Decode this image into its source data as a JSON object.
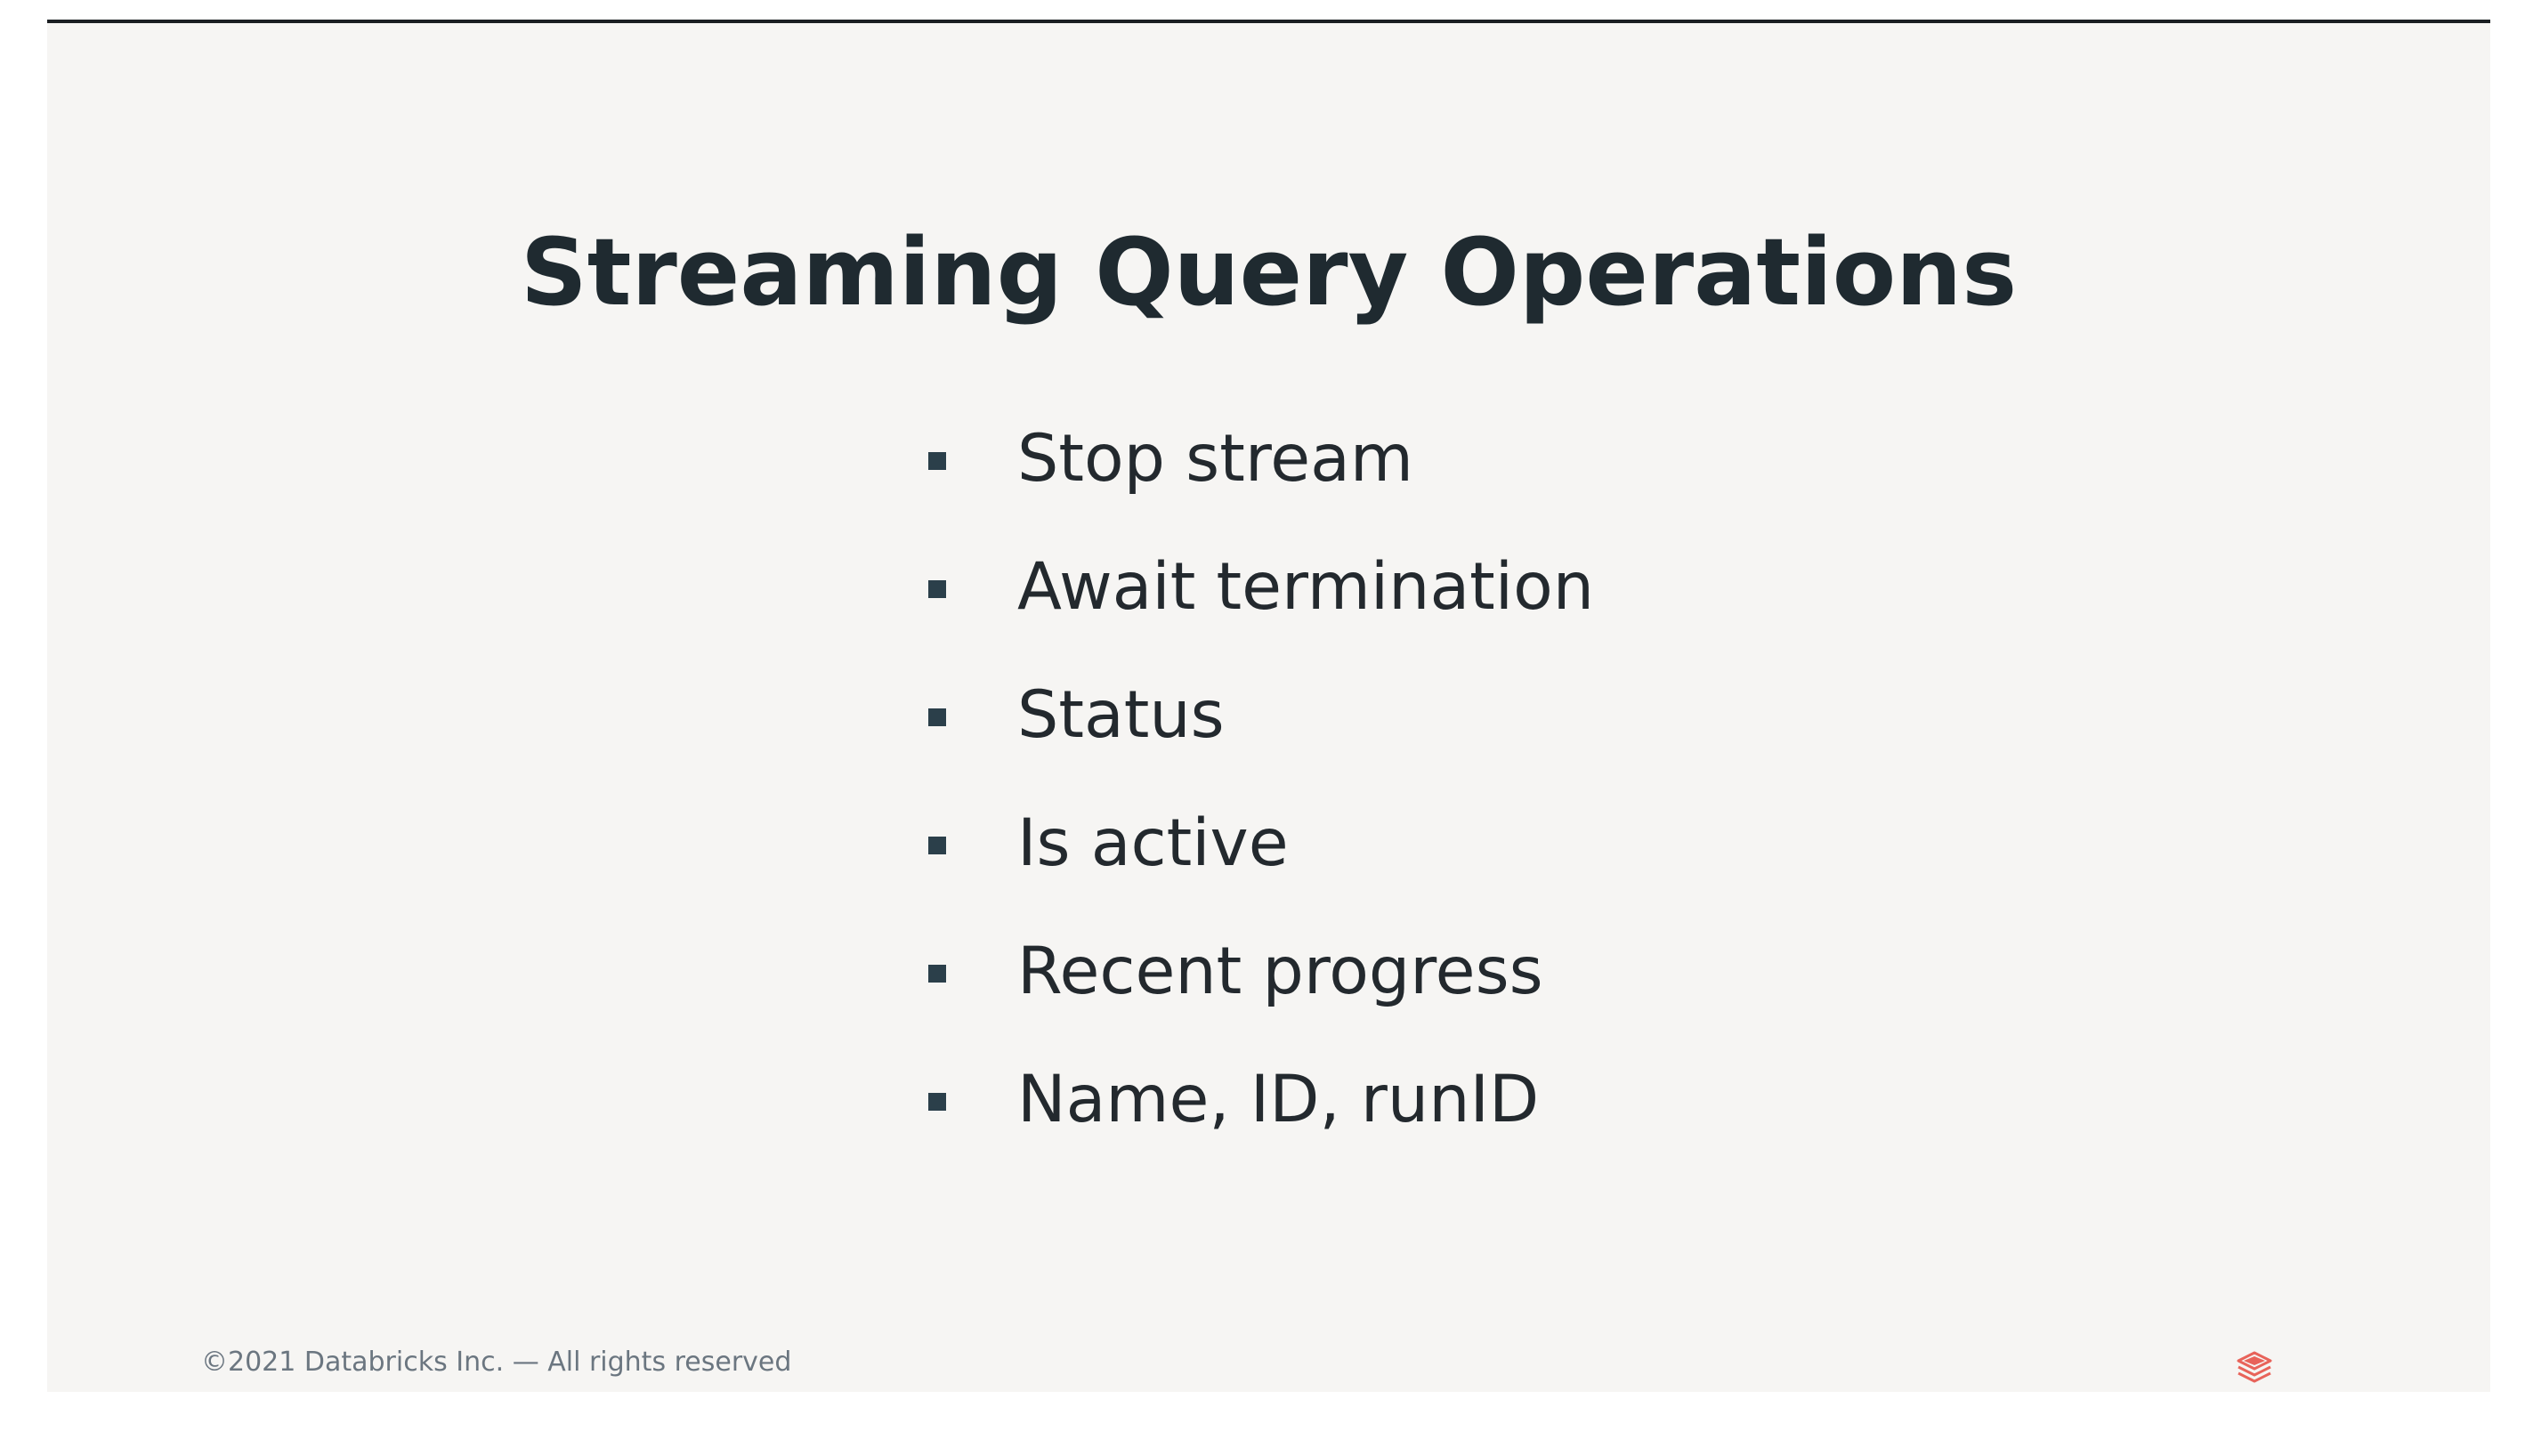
{
  "slide": {
    "title": "Streaming Query Operations",
    "bullets": [
      "Stop stream",
      "Await termination",
      "Status",
      "Is active",
      "Recent progress",
      "Name, ID, runID"
    ],
    "footer": "©2021 Databricks Inc. — All rights reserved",
    "logo_icon": "databricks-logo-icon"
  },
  "colors": {
    "background": "#f6f5f3",
    "title": "#1f2a30",
    "bullet_marker": "#2b3f4a",
    "footer": "#6b7680",
    "logo": "#e8635a"
  }
}
